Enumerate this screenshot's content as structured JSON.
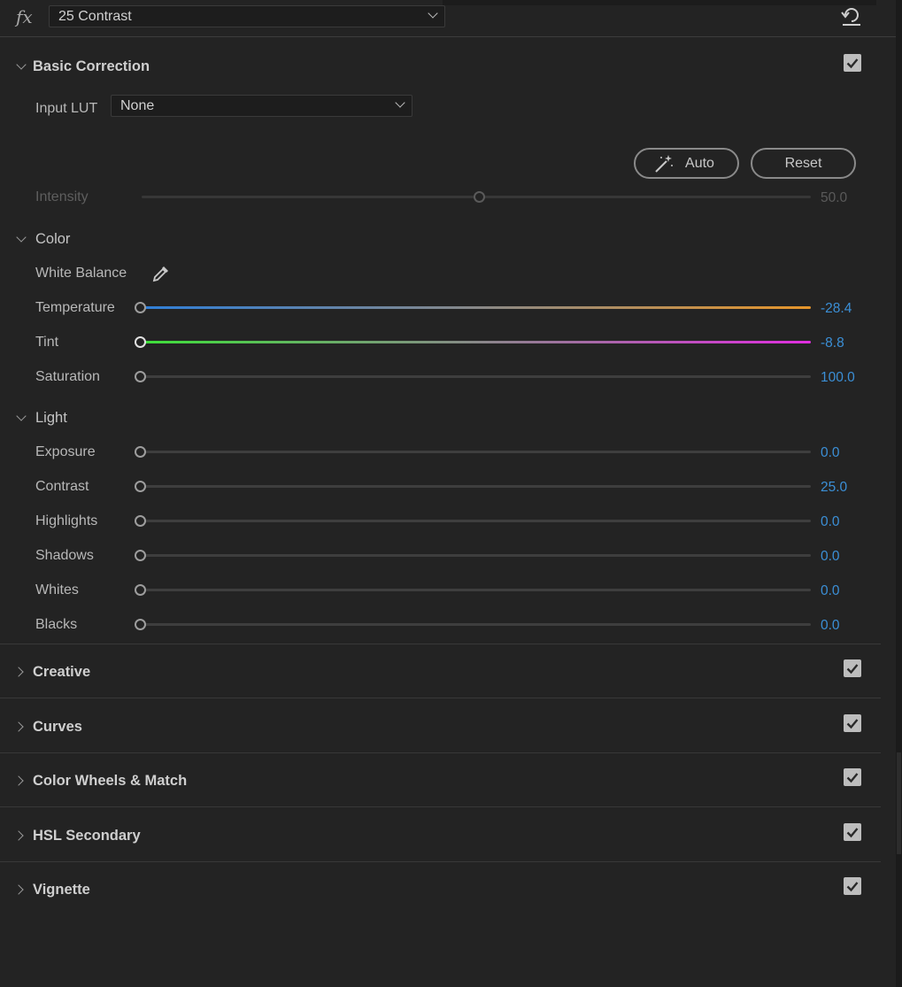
{
  "header": {
    "fx_label": "fx",
    "preset": "25 Contrast"
  },
  "basic_correction": {
    "title": "Basic Correction",
    "enabled": true,
    "input_lut_label": "Input LUT",
    "input_lut_value": "None",
    "auto_label": "Auto",
    "reset_label": "Reset",
    "intensity": {
      "label": "Intensity",
      "value": "50.0",
      "fraction": 0.5
    }
  },
  "color": {
    "title": "Color",
    "white_balance_label": "White Balance",
    "temperature": {
      "label": "Temperature",
      "value": "-28.4"
    },
    "tint": {
      "label": "Tint",
      "value": "-8.8"
    },
    "saturation": {
      "label": "Saturation",
      "value": "100.0"
    }
  },
  "light": {
    "title": "Light",
    "exposure": {
      "label": "Exposure",
      "value": "0.0"
    },
    "contrast": {
      "label": "Contrast",
      "value": "25.0"
    },
    "highlights": {
      "label": "Highlights",
      "value": "0.0"
    },
    "shadows": {
      "label": "Shadows",
      "value": "0.0"
    },
    "whites": {
      "label": "Whites",
      "value": "0.0"
    },
    "blacks": {
      "label": "Blacks",
      "value": "0.0"
    }
  },
  "sections": [
    {
      "title": "Creative",
      "enabled": true
    },
    {
      "title": "Curves",
      "enabled": true
    },
    {
      "title": "Color Wheels & Match",
      "enabled": true
    },
    {
      "title": "HSL Secondary",
      "enabled": true
    },
    {
      "title": "Vignette",
      "enabled": true
    }
  ],
  "colors": {
    "value_blue": "#3b8fd6",
    "temperature_left": "#2f7fd8",
    "temperature_right": "#e6952a",
    "tint_left": "#3ee03a",
    "tint_right": "#e02ee0"
  }
}
